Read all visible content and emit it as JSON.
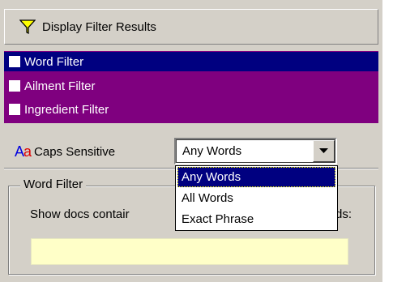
{
  "header": {
    "title": "Display Filter Results",
    "icon": "filter-funnel-icon"
  },
  "filters": [
    {
      "label": "Word Filter",
      "selected": true,
      "checked": false
    },
    {
      "label": "Ailment Filter",
      "selected": false,
      "checked": false
    },
    {
      "label": "Ingredient Filter",
      "selected": false,
      "checked": false
    }
  ],
  "caps": {
    "icon_text_upper": "A",
    "icon_text_lower": "a",
    "label": "Caps Sensitive"
  },
  "match_mode": {
    "value": "Any Words",
    "options": [
      "Any Words",
      "All Words",
      "Exact Phrase"
    ],
    "highlighted": 0
  },
  "word_filter_group": {
    "legend": "Word Filter",
    "description_left": "Show docs contair",
    "description_right": "ds:",
    "input_value": ""
  },
  "colors": {
    "panel": "#d4d0c8",
    "list_bg": "#7f007f",
    "selected_row": "#000080",
    "input_bg": "#ffffc8"
  }
}
